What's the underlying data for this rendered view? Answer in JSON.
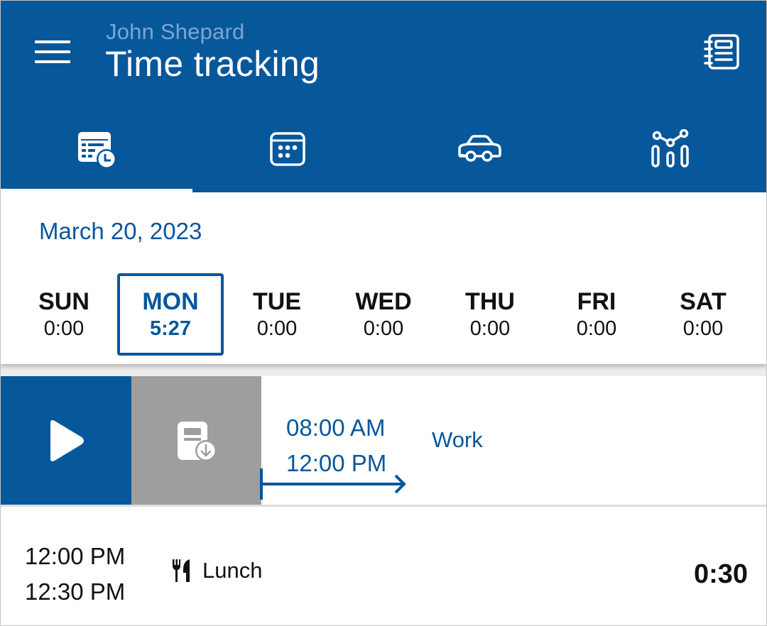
{
  "header": {
    "user_name": "John Shepard",
    "title": "Time tracking",
    "menu_icon": "hamburger-menu-icon",
    "action_icon": "notebook-icon"
  },
  "tabs": [
    {
      "icon": "timesheet-clock-icon",
      "selected": true
    },
    {
      "icon": "calendar-icon",
      "selected": false
    },
    {
      "icon": "car-icon",
      "selected": false
    },
    {
      "icon": "statistics-chart-icon",
      "selected": false
    }
  ],
  "week": {
    "date": "March 20, 2023",
    "days": [
      {
        "name": "SUN",
        "value": "0:00",
        "selected": false
      },
      {
        "name": "MON",
        "value": "5:27",
        "selected": true
      },
      {
        "name": "TUE",
        "value": "0:00",
        "selected": false
      },
      {
        "name": "WED",
        "value": "0:00",
        "selected": false
      },
      {
        "name": "THU",
        "value": "0:00",
        "selected": false
      },
      {
        "name": "FRI",
        "value": "0:00",
        "selected": false
      },
      {
        "name": "SAT",
        "value": "0:00",
        "selected": false
      }
    ]
  },
  "entries": [
    {
      "start": "08:00 AM",
      "end": "12:00 PM",
      "type": "Work",
      "actions": {
        "play_icon": "play-icon",
        "export_icon": "document-download-icon"
      },
      "indicator_icon": "ongoing-arrow-icon"
    },
    {
      "start": "12:00 PM",
      "end": "12:30 PM",
      "type": "Lunch",
      "type_icon": "fork-knife-icon",
      "duration": "0:30"
    }
  ],
  "colors": {
    "primary": "#07579b",
    "subtitle": "#79a6d2",
    "swipe_action_gray": "#9e9e9e",
    "text": "#111111"
  }
}
